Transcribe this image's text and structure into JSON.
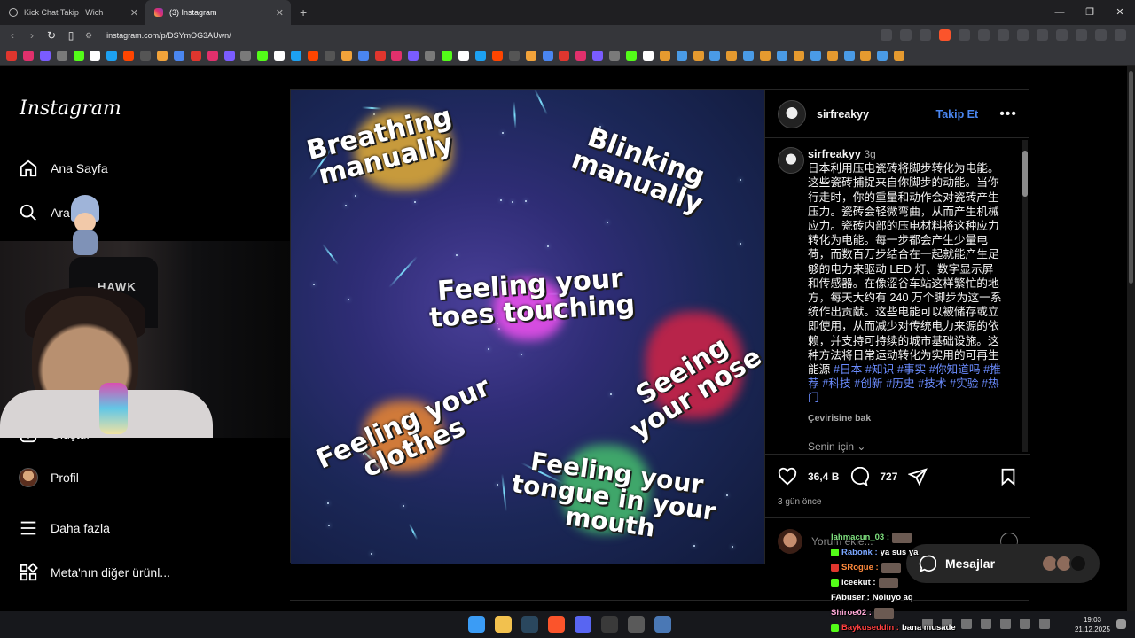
{
  "browser": {
    "tabs": [
      {
        "title": "Kick Chat Takip | Wich",
        "active": false
      },
      {
        "title": "(3) Instagram",
        "active": true
      }
    ],
    "url": "instagram.com/p/DSYmOG3AUwn/"
  },
  "sidebar": {
    "logo": "Instagram",
    "items": [
      {
        "label": "Ana Sayfa",
        "icon": "home-icon"
      },
      {
        "label": "Ara",
        "icon": "search-icon"
      },
      {
        "label": "Oluştur",
        "icon": "create-icon"
      },
      {
        "label": "Profil",
        "icon": "avatar"
      },
      {
        "label": "Daha fazla",
        "icon": "menu-icon"
      },
      {
        "label": "Meta'nın diğer ürünl...",
        "icon": "apps-icon"
      }
    ]
  },
  "webcam": {
    "chair_brand": "HAWK"
  },
  "meme": {
    "labels": [
      "Breathing\nmanually",
      "Blinking\nmanually",
      "Feeling your\ntoes touching",
      "Seeing\nyour nose",
      "Feeling your\nclothes",
      "Feeling your\ntongue in your\nmouth"
    ]
  },
  "post": {
    "username": "sirfreakyy",
    "follow_label": "Takip Et",
    "caption_user": "sirfreakyy",
    "caption_age": "3g",
    "caption_text": "日本利用压电瓷砖将脚步转化为电能。这些瓷砖捕捉来自你脚步的动能。当你行走时，你的重量和动作会对瓷砖产生压力。瓷砖会轻微弯曲，从而产生机械应力。瓷砖内部的压电材料将这种应力转化为电能。每一步都会产生少量电荷，而数百万步结合在一起就能产生足够的电力来驱动 LED 灯、数字显示屏和传感器。在像涩谷车站这样繁忙的地方，每天大约有 240 万个脚步为这一系统作出贡献。这些电能可以被储存或立即使用，从而减少对传统电力来源的依赖，并支持可持续的城市基础设施。这种方法将日常运动转化为实用的可再生能源",
    "hashtags": "#日本 #知识 #事实 #你知道吗 #推荐 #科技 #创新 #历史 #技术 #实验 #热门",
    "translate_label": "Çevirisine bak",
    "for_you_label": "Senin için",
    "likes": "36,4 B",
    "comments": "727",
    "time_ago": "3 gün önce",
    "comment_placeholder": "Yorum ekle..."
  },
  "messages": {
    "label": "Mesajlar"
  },
  "chat_overlay": [
    {
      "user": "lahmacun_03",
      "text": "",
      "color": "#7ee07e",
      "badge": ""
    },
    {
      "user": "Rabonk",
      "text": "ya sus ya",
      "color": "#7aa6ff",
      "badge": "#53fc18"
    },
    {
      "user": "SRogue",
      "text": "",
      "color": "#ff8a3d",
      "badge": "#e0362e"
    },
    {
      "user": "iceekut",
      "text": "",
      "color": "#ffffff",
      "badge": "#53fc18"
    },
    {
      "user": "FAbuser",
      "text": "Noluyo aq",
      "color": "#ffffff",
      "badge": ""
    },
    {
      "user": "Shiroe02",
      "text": "",
      "color": "#ffa9d8",
      "badge": ""
    },
    {
      "user": "Baykuseddin",
      "text": "bana musade",
      "color": "#ff4040",
      "badge": "#53fc18"
    }
  ],
  "taskbar": {
    "time": "19:03",
    "date": "21.12.2025"
  },
  "colors": {
    "accent": "#4a86f0",
    "hashtag": "#6b8cff",
    "background": "#000000"
  }
}
